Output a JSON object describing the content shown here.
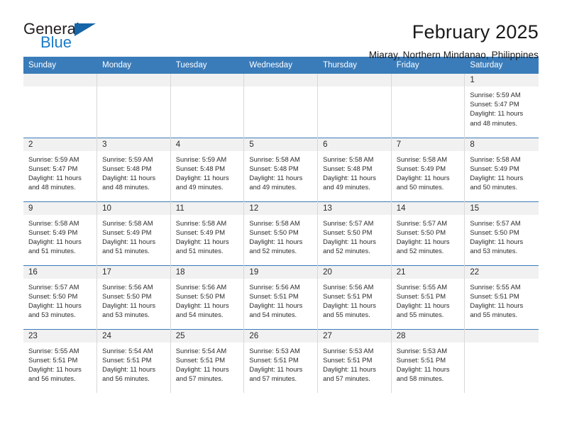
{
  "logo": {
    "name_part1": "General",
    "name_part2": "Blue",
    "triangle_color": "#1565a8",
    "blue_color": "#1a7bc9"
  },
  "header": {
    "title": "February 2025",
    "subtitle": "Miaray, Northern Mindanao, Philippines"
  },
  "theme": {
    "header_blue": "#3a7cba",
    "daynum_band": "#f1f1f1",
    "cell_border": "#d8d8d8",
    "text": "#2b2b2b"
  },
  "weekday_headers": [
    "Sunday",
    "Monday",
    "Tuesday",
    "Wednesday",
    "Thursday",
    "Friday",
    "Saturday"
  ],
  "weeks": [
    [
      {
        "empty": true
      },
      {
        "empty": true
      },
      {
        "empty": true
      },
      {
        "empty": true
      },
      {
        "empty": true
      },
      {
        "empty": true
      },
      {
        "day": "1",
        "sunrise": "Sunrise: 5:59 AM",
        "sunset": "Sunset: 5:47 PM",
        "daylight_l1": "Daylight: 11 hours",
        "daylight_l2": "and 48 minutes."
      }
    ],
    [
      {
        "day": "2",
        "sunrise": "Sunrise: 5:59 AM",
        "sunset": "Sunset: 5:47 PM",
        "daylight_l1": "Daylight: 11 hours",
        "daylight_l2": "and 48 minutes."
      },
      {
        "day": "3",
        "sunrise": "Sunrise: 5:59 AM",
        "sunset": "Sunset: 5:48 PM",
        "daylight_l1": "Daylight: 11 hours",
        "daylight_l2": "and 48 minutes."
      },
      {
        "day": "4",
        "sunrise": "Sunrise: 5:59 AM",
        "sunset": "Sunset: 5:48 PM",
        "daylight_l1": "Daylight: 11 hours",
        "daylight_l2": "and 49 minutes."
      },
      {
        "day": "5",
        "sunrise": "Sunrise: 5:58 AM",
        "sunset": "Sunset: 5:48 PM",
        "daylight_l1": "Daylight: 11 hours",
        "daylight_l2": "and 49 minutes."
      },
      {
        "day": "6",
        "sunrise": "Sunrise: 5:58 AM",
        "sunset": "Sunset: 5:48 PM",
        "daylight_l1": "Daylight: 11 hours",
        "daylight_l2": "and 49 minutes."
      },
      {
        "day": "7",
        "sunrise": "Sunrise: 5:58 AM",
        "sunset": "Sunset: 5:49 PM",
        "daylight_l1": "Daylight: 11 hours",
        "daylight_l2": "and 50 minutes."
      },
      {
        "day": "8",
        "sunrise": "Sunrise: 5:58 AM",
        "sunset": "Sunset: 5:49 PM",
        "daylight_l1": "Daylight: 11 hours",
        "daylight_l2": "and 50 minutes."
      }
    ],
    [
      {
        "day": "9",
        "sunrise": "Sunrise: 5:58 AM",
        "sunset": "Sunset: 5:49 PM",
        "daylight_l1": "Daylight: 11 hours",
        "daylight_l2": "and 51 minutes."
      },
      {
        "day": "10",
        "sunrise": "Sunrise: 5:58 AM",
        "sunset": "Sunset: 5:49 PM",
        "daylight_l1": "Daylight: 11 hours",
        "daylight_l2": "and 51 minutes."
      },
      {
        "day": "11",
        "sunrise": "Sunrise: 5:58 AM",
        "sunset": "Sunset: 5:49 PM",
        "daylight_l1": "Daylight: 11 hours",
        "daylight_l2": "and 51 minutes."
      },
      {
        "day": "12",
        "sunrise": "Sunrise: 5:58 AM",
        "sunset": "Sunset: 5:50 PM",
        "daylight_l1": "Daylight: 11 hours",
        "daylight_l2": "and 52 minutes."
      },
      {
        "day": "13",
        "sunrise": "Sunrise: 5:57 AM",
        "sunset": "Sunset: 5:50 PM",
        "daylight_l1": "Daylight: 11 hours",
        "daylight_l2": "and 52 minutes."
      },
      {
        "day": "14",
        "sunrise": "Sunrise: 5:57 AM",
        "sunset": "Sunset: 5:50 PM",
        "daylight_l1": "Daylight: 11 hours",
        "daylight_l2": "and 52 minutes."
      },
      {
        "day": "15",
        "sunrise": "Sunrise: 5:57 AM",
        "sunset": "Sunset: 5:50 PM",
        "daylight_l1": "Daylight: 11 hours",
        "daylight_l2": "and 53 minutes."
      }
    ],
    [
      {
        "day": "16",
        "sunrise": "Sunrise: 5:57 AM",
        "sunset": "Sunset: 5:50 PM",
        "daylight_l1": "Daylight: 11 hours",
        "daylight_l2": "and 53 minutes."
      },
      {
        "day": "17",
        "sunrise": "Sunrise: 5:56 AM",
        "sunset": "Sunset: 5:50 PM",
        "daylight_l1": "Daylight: 11 hours",
        "daylight_l2": "and 53 minutes."
      },
      {
        "day": "18",
        "sunrise": "Sunrise: 5:56 AM",
        "sunset": "Sunset: 5:50 PM",
        "daylight_l1": "Daylight: 11 hours",
        "daylight_l2": "and 54 minutes."
      },
      {
        "day": "19",
        "sunrise": "Sunrise: 5:56 AM",
        "sunset": "Sunset: 5:51 PM",
        "daylight_l1": "Daylight: 11 hours",
        "daylight_l2": "and 54 minutes."
      },
      {
        "day": "20",
        "sunrise": "Sunrise: 5:56 AM",
        "sunset": "Sunset: 5:51 PM",
        "daylight_l1": "Daylight: 11 hours",
        "daylight_l2": "and 55 minutes."
      },
      {
        "day": "21",
        "sunrise": "Sunrise: 5:55 AM",
        "sunset": "Sunset: 5:51 PM",
        "daylight_l1": "Daylight: 11 hours",
        "daylight_l2": "and 55 minutes."
      },
      {
        "day": "22",
        "sunrise": "Sunrise: 5:55 AM",
        "sunset": "Sunset: 5:51 PM",
        "daylight_l1": "Daylight: 11 hours",
        "daylight_l2": "and 55 minutes."
      }
    ],
    [
      {
        "day": "23",
        "sunrise": "Sunrise: 5:55 AM",
        "sunset": "Sunset: 5:51 PM",
        "daylight_l1": "Daylight: 11 hours",
        "daylight_l2": "and 56 minutes."
      },
      {
        "day": "24",
        "sunrise": "Sunrise: 5:54 AM",
        "sunset": "Sunset: 5:51 PM",
        "daylight_l1": "Daylight: 11 hours",
        "daylight_l2": "and 56 minutes."
      },
      {
        "day": "25",
        "sunrise": "Sunrise: 5:54 AM",
        "sunset": "Sunset: 5:51 PM",
        "daylight_l1": "Daylight: 11 hours",
        "daylight_l2": "and 57 minutes."
      },
      {
        "day": "26",
        "sunrise": "Sunrise: 5:53 AM",
        "sunset": "Sunset: 5:51 PM",
        "daylight_l1": "Daylight: 11 hours",
        "daylight_l2": "and 57 minutes."
      },
      {
        "day": "27",
        "sunrise": "Sunrise: 5:53 AM",
        "sunset": "Sunset: 5:51 PM",
        "daylight_l1": "Daylight: 11 hours",
        "daylight_l2": "and 57 minutes."
      },
      {
        "day": "28",
        "sunrise": "Sunrise: 5:53 AM",
        "sunset": "Sunset: 5:51 PM",
        "daylight_l1": "Daylight: 11 hours",
        "daylight_l2": "and 58 minutes."
      },
      {
        "empty": true
      }
    ]
  ]
}
